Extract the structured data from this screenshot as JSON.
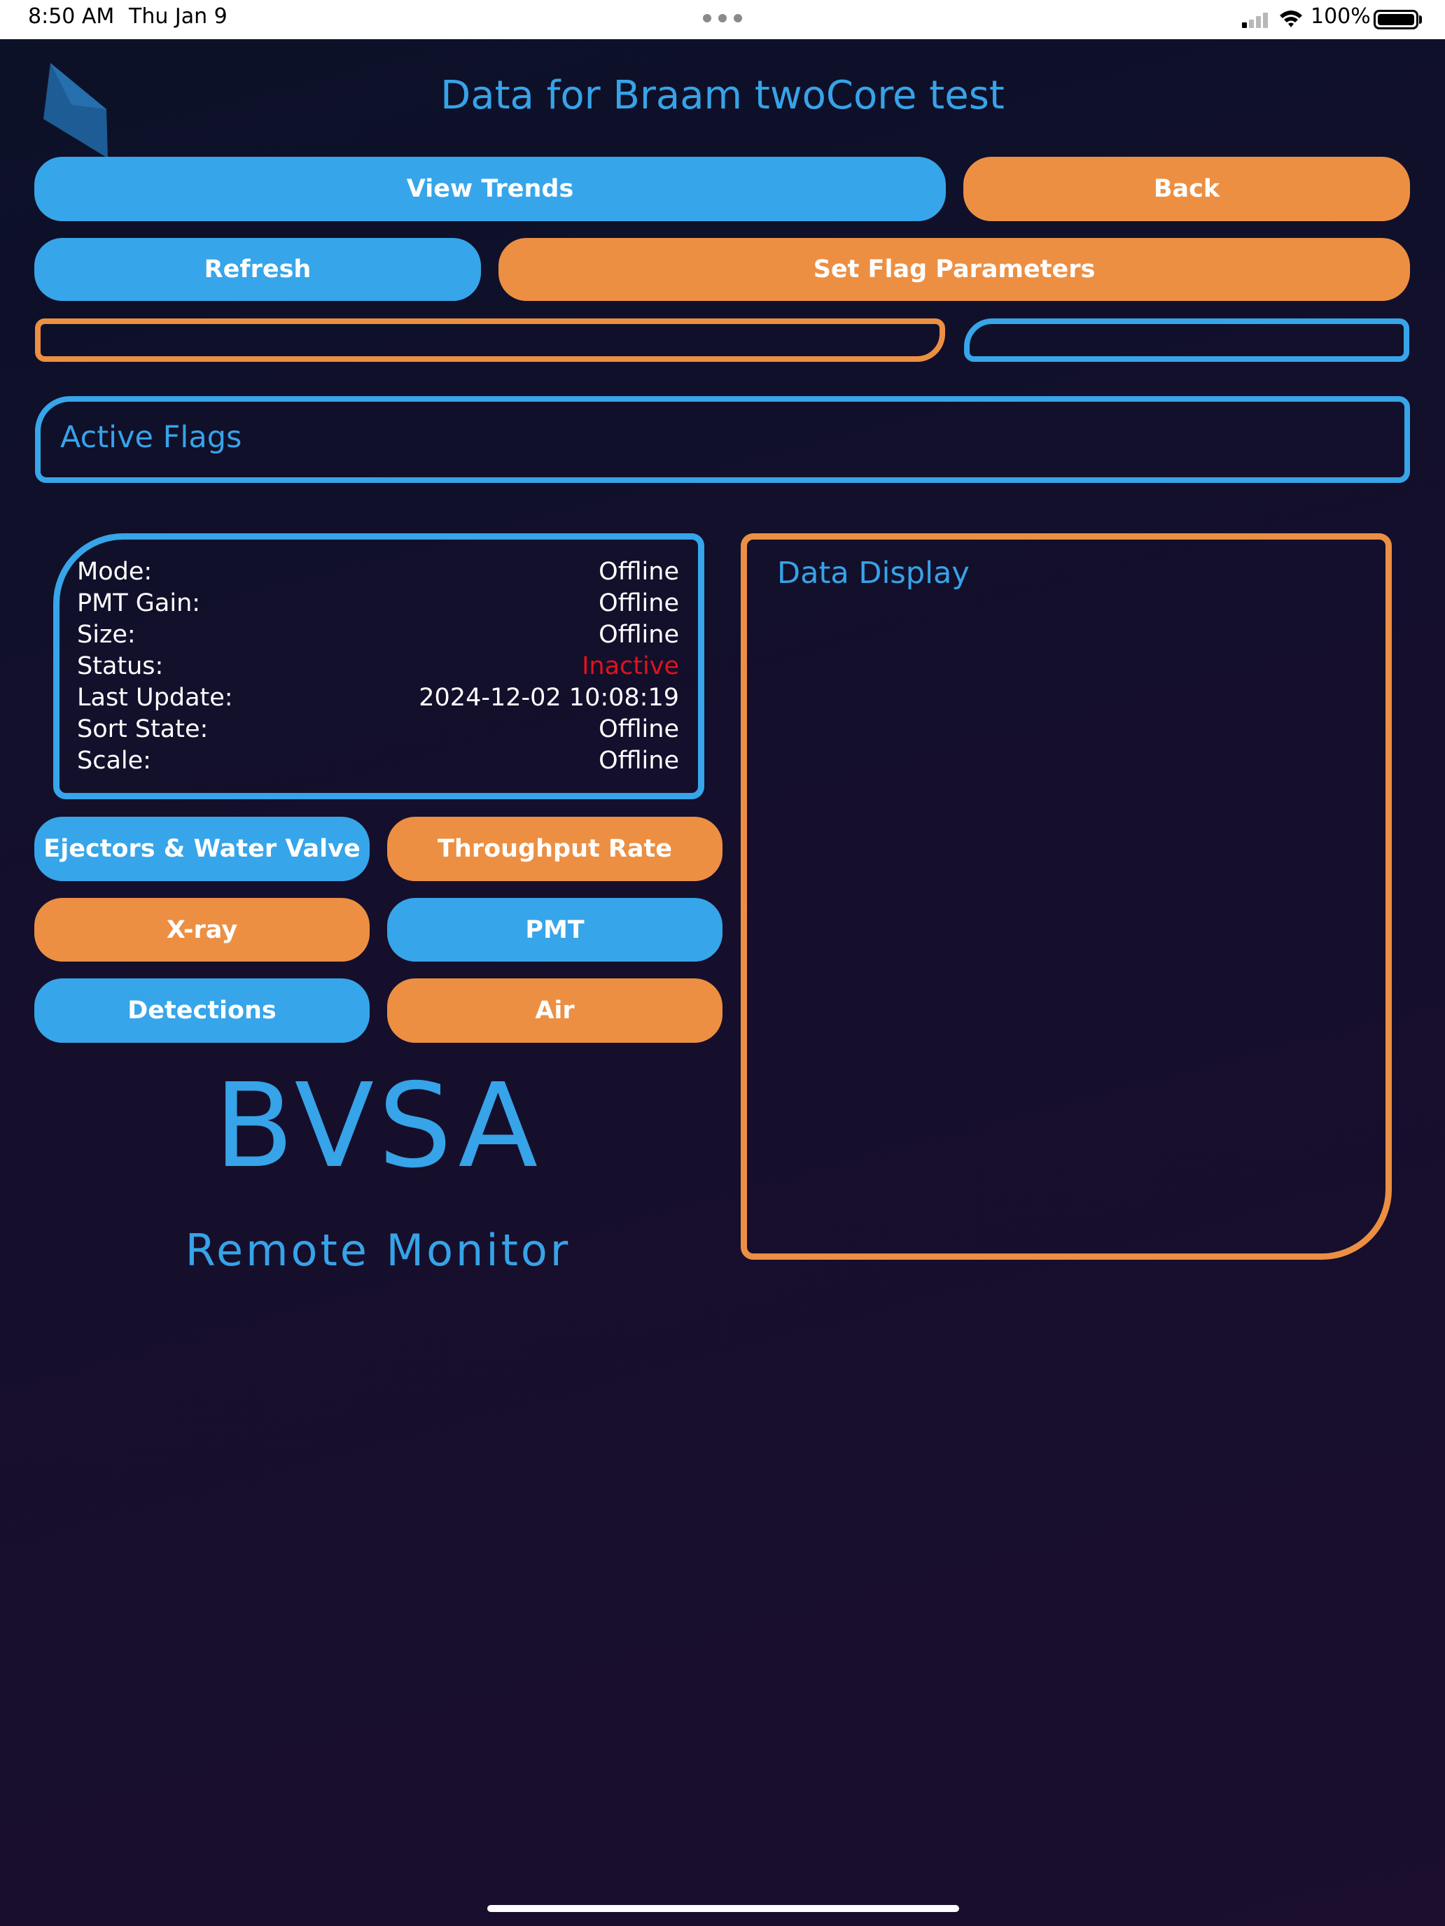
{
  "status_bar": {
    "time": "8:50 AM",
    "date": "Thu Jan 9",
    "battery": "100%"
  },
  "header": {
    "title": "Data for Braam twoCore test"
  },
  "toolbar": {
    "view_trends": "View Trends",
    "back": "Back",
    "refresh": "Refresh",
    "set_flag_parameters": "Set Flag Parameters"
  },
  "active_flags": {
    "label": "Active Flags"
  },
  "info": {
    "rows": [
      {
        "key": "Mode:",
        "value": "Offline"
      },
      {
        "key": "PMT Gain:",
        "value": "Offline"
      },
      {
        "key": "Size:",
        "value": "Offline"
      },
      {
        "key": "Status:",
        "value": "Inactive"
      },
      {
        "key": "Last Update:",
        "value": "2024-12-02 10:08:19"
      },
      {
        "key": "Sort State:",
        "value": "Offline"
      },
      {
        "key": "Scale:",
        "value": "Offline"
      }
    ]
  },
  "nav_buttons": {
    "ejectors": "Ejectors & Water Valve",
    "throughput": "Throughput Rate",
    "xray": "X-ray",
    "pmt": "PMT",
    "detections": "Detections",
    "air": "Air"
  },
  "data_display": {
    "label": "Data Display"
  },
  "branding": {
    "logo_text": "BVSA",
    "subtitle": "Remote Monitor"
  },
  "colors": {
    "accent_blue": "#37a5e9",
    "accent_orange": "#ec8f43",
    "status_inactive": "#e2121c",
    "background": "#150f2c"
  }
}
